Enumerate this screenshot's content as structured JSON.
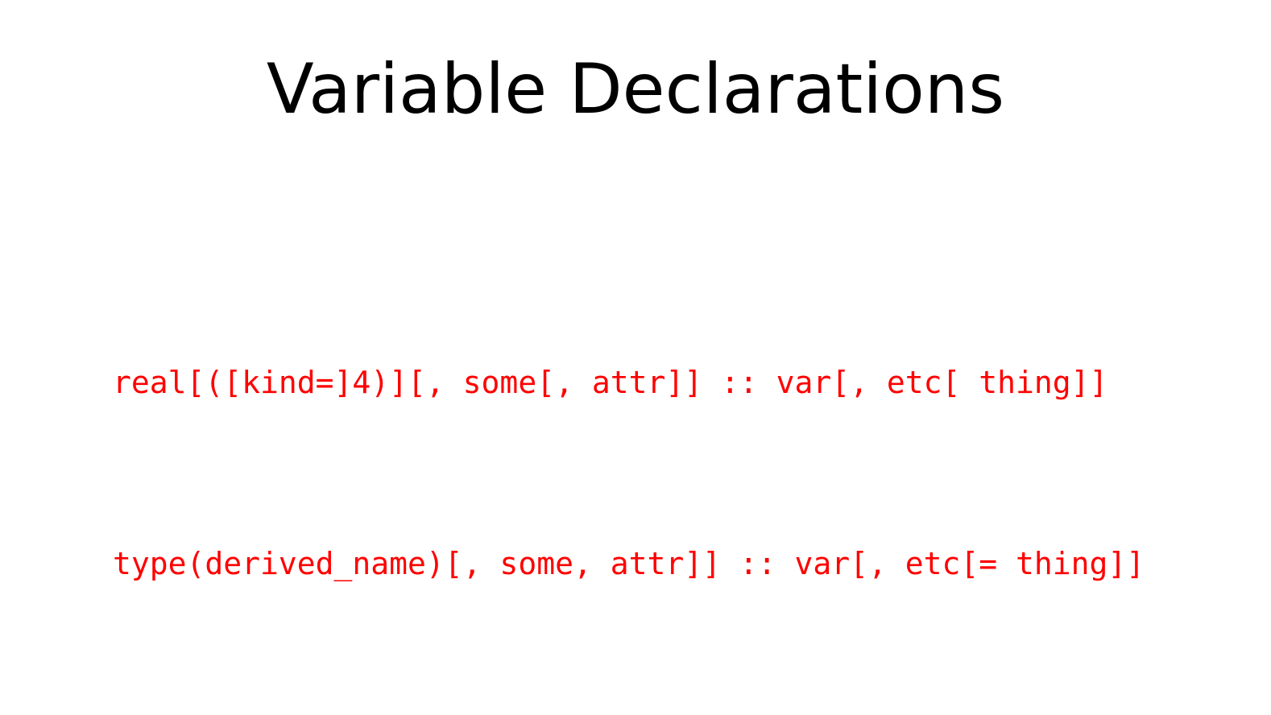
{
  "slide": {
    "title": "Variable Declarations",
    "code_color": "#ff0000",
    "code_lines": [
      "real[([kind=]4)][, some[, attr]] :: var[, etc[ thing]]",
      "type(derived_name)[, some, attr]] :: var[, etc[= thing]]"
    ]
  }
}
